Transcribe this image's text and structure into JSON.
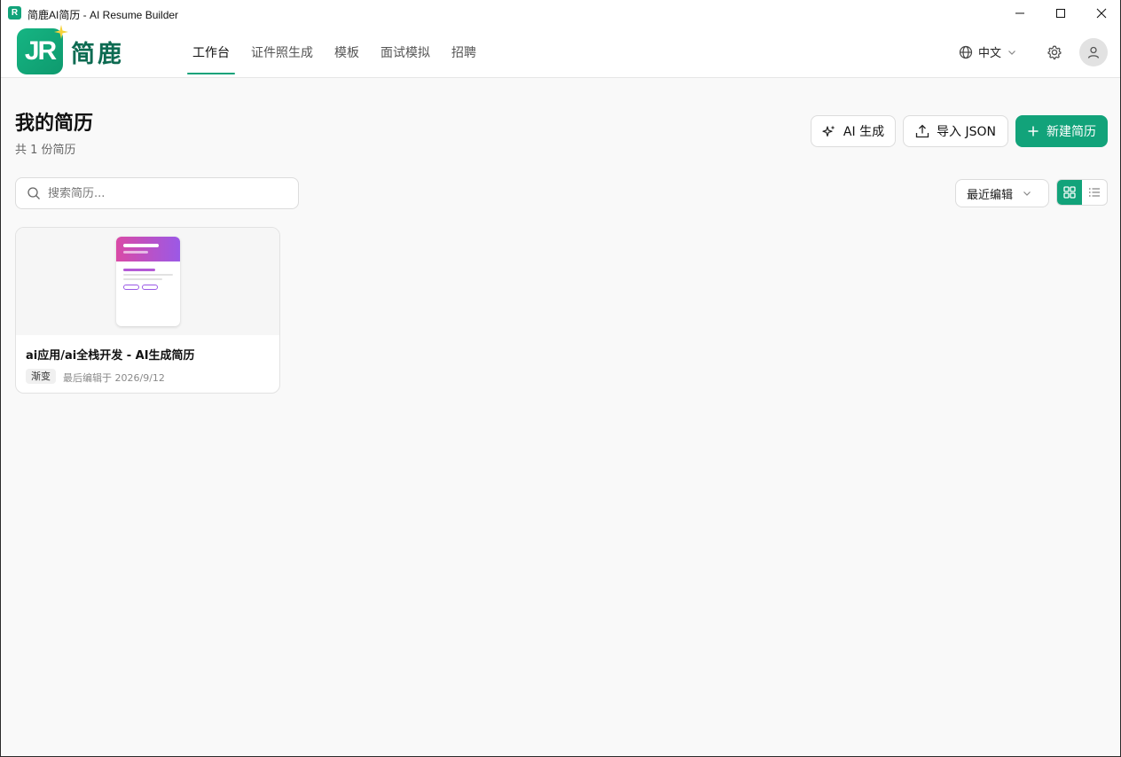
{
  "window": {
    "title": "简鹿AI简历 - AI Resume Builder",
    "app_icon_letter": "R"
  },
  "header": {
    "logo_letters": "JR",
    "brand_name": "简鹿",
    "nav": [
      {
        "label": "工作台",
        "active": true
      },
      {
        "label": "证件照生成",
        "active": false
      },
      {
        "label": "模板",
        "active": false
      },
      {
        "label": "面试模拟",
        "active": false
      },
      {
        "label": "招聘",
        "active": false
      }
    ],
    "language": "中文"
  },
  "main": {
    "title": "我的简历",
    "subtitle": "共 1 份简历",
    "actions": {
      "ai_generate": "AI 生成",
      "import_json": "导入 JSON",
      "new_resume": "新建简历"
    },
    "search": {
      "placeholder": "搜索简历..."
    },
    "sort": {
      "selected": "最近编辑"
    },
    "view_mode": "grid",
    "resumes": [
      {
        "title": "ai应用/ai全栈开发 - AI生成简历",
        "template": "渐变",
        "edited": "最后编辑于 2026/9/12"
      }
    ]
  },
  "colors": {
    "accent": "#12a37a",
    "brand_text": "#0d6b52",
    "template_gradient_start": "#d94aa6",
    "template_gradient_end": "#9b59e6"
  }
}
